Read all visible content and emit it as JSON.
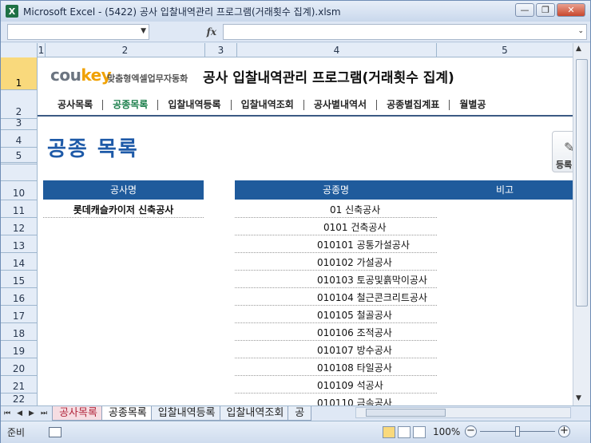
{
  "window": {
    "title": "Microsoft Excel - (5422) 공사 입찰내역관리 프로그램(거래횟수 집계).xlsm",
    "app_icon_letter": "X",
    "minimize": "—",
    "restore": "❐",
    "close": "✕"
  },
  "formula_bar": {
    "name_box": "",
    "fx": "fx",
    "content": ""
  },
  "columns": [
    "1",
    "2",
    "3",
    "4",
    "5"
  ],
  "rows": [
    "1",
    "2",
    "3",
    "4",
    "5",
    "10",
    "11",
    "12",
    "13",
    "14",
    "15",
    "16",
    "17",
    "18",
    "19",
    "20",
    "21",
    "22"
  ],
  "logo": {
    "part1": "cou",
    "part2": "key",
    "sub": "맞춤형엑셀업무자동화"
  },
  "page_title": "공사 입찰내역관리 프로그램(거래횟수 집계)",
  "nav": [
    {
      "label": "공사목록"
    },
    {
      "label": "공종목록"
    },
    {
      "label": "입찰내역등록"
    },
    {
      "label": "입찰내역조회"
    },
    {
      "label": "공사별내역서"
    },
    {
      "label": "공종별집계표"
    },
    {
      "label": "월별공"
    }
  ],
  "section_title": "공종 목록",
  "register_button": {
    "label": "등록",
    "icon": "pencil-icon"
  },
  "table_left": {
    "header": "공사명",
    "rows": [
      "롯데캐슬카이저 신축공사"
    ]
  },
  "table_right": {
    "header_name": "공종명",
    "header_note": "비고",
    "rows": [
      "01  신축공사",
      "0101  건축공사",
      "010101  공통가설공사",
      "010102  가설공사",
      "010103  토공및흙막이공사",
      "010104  철근콘크리트공사",
      "010105  철골공사",
      "010106  조적공사",
      "010107  방수공사",
      "010108  타일공사",
      "010109  석공사",
      "010110  금속공사"
    ]
  },
  "sheet_tabs": [
    {
      "label": "공사목록"
    },
    {
      "label": "공종목록"
    },
    {
      "label": "입찰내역등록"
    },
    {
      "label": "입찰내역조회"
    },
    {
      "label": "공"
    }
  ],
  "status": {
    "ready": "준비",
    "zoom": "100%",
    "zoom_minus": "−",
    "zoom_plus": "+"
  }
}
